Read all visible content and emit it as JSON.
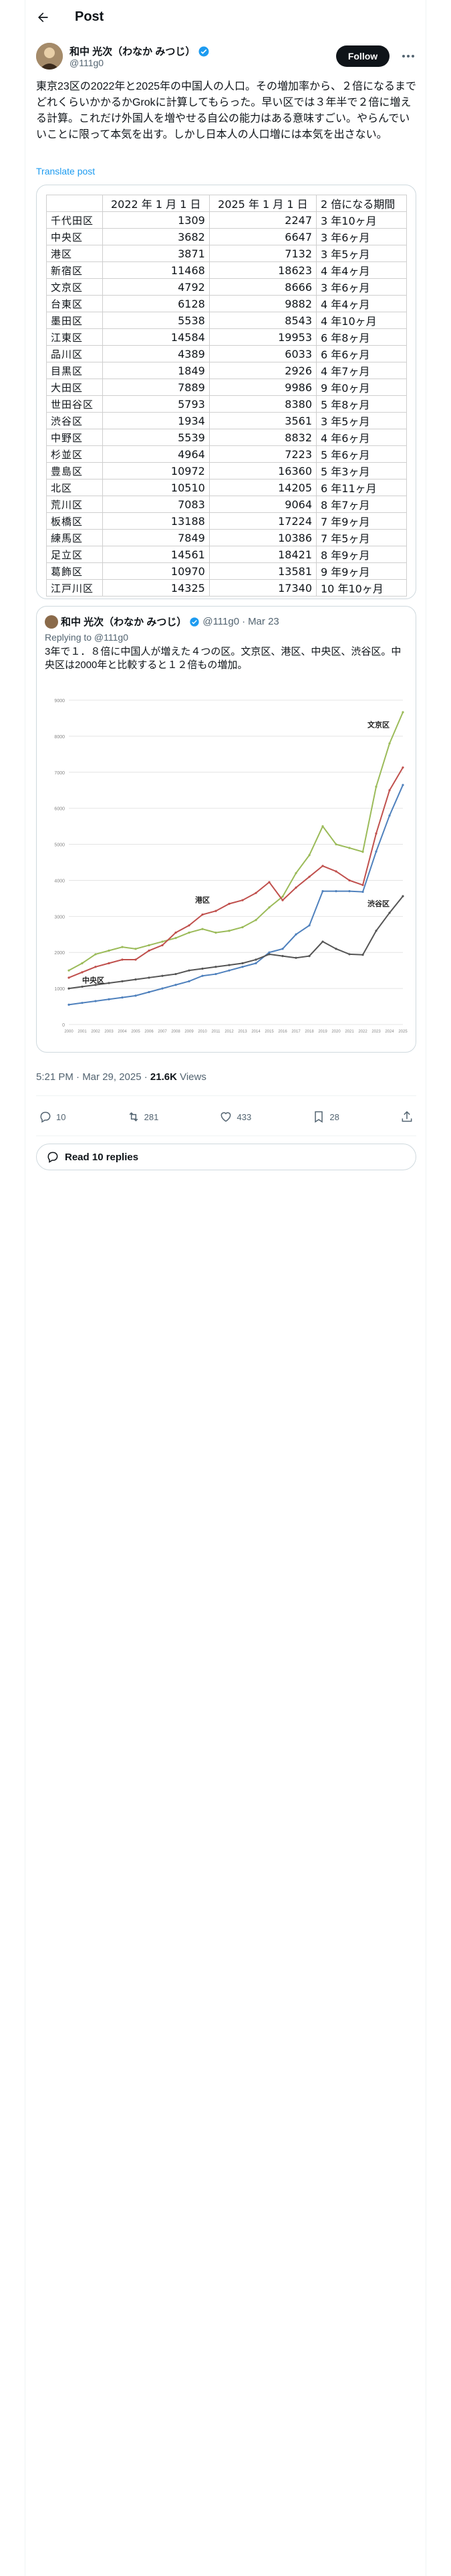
{
  "header": {
    "title": "Post"
  },
  "author": {
    "name": "和中 光次（わなか みつじ）",
    "handle": "@111g0",
    "follow_label": "Follow"
  },
  "post": {
    "text": "東京23区の2022年と2025年の中国人の人口。その増加率から、２倍になるまでどれくらいかかるかGrokに計算してもらった。早い区では３年半で２倍に増える計算。これだけ外国人を増やせる自公の能力はある意味すごい。やらんでいいことに限って本気を出す。しかし日本人の人口増には本気を出さない。",
    "translate_label": "Translate post"
  },
  "table": {
    "headers": [
      "",
      "2022 年 1 月 1 日",
      "2025 年 1 月 1 日",
      "2 倍になる期間"
    ],
    "rows": [
      [
        "千代田区",
        "1309",
        "2247",
        "3 年10ヶ月"
      ],
      [
        "中央区",
        "3682",
        "6647",
        "3 年6ヶ月"
      ],
      [
        "港区",
        "3871",
        "7132",
        "3 年5ヶ月"
      ],
      [
        "新宿区",
        "11468",
        "18623",
        "4 年4ヶ月"
      ],
      [
        "文京区",
        "4792",
        "8666",
        "3 年6ヶ月"
      ],
      [
        "台東区",
        "6128",
        "9882",
        "4 年4ヶ月"
      ],
      [
        "墨田区",
        "5538",
        "8543",
        "4 年10ヶ月"
      ],
      [
        "江東区",
        "14584",
        "19953",
        "6 年8ヶ月"
      ],
      [
        "品川区",
        "4389",
        "6033",
        "6 年6ヶ月"
      ],
      [
        "目黒区",
        "1849",
        "2926",
        "4 年7ヶ月"
      ],
      [
        "大田区",
        "7889",
        "9986",
        "9 年0ヶ月"
      ],
      [
        "世田谷区",
        "5793",
        "8380",
        "5 年8ヶ月"
      ],
      [
        "渋谷区",
        "1934",
        "3561",
        "3 年5ヶ月"
      ],
      [
        "中野区",
        "5539",
        "8832",
        "4 年6ヶ月"
      ],
      [
        "杉並区",
        "4964",
        "7223",
        "5 年6ヶ月"
      ],
      [
        "豊島区",
        "10972",
        "16360",
        "5 年3ヶ月"
      ],
      [
        "北区",
        "10510",
        "14205",
        "6 年11ヶ月"
      ],
      [
        "荒川区",
        "7083",
        "9064",
        "8 年7ヶ月"
      ],
      [
        "板橋区",
        "13188",
        "17224",
        "7 年9ヶ月"
      ],
      [
        "練馬区",
        "7849",
        "10386",
        "7 年5ヶ月"
      ],
      [
        "足立区",
        "14561",
        "18421",
        "8 年9ヶ月"
      ],
      [
        "葛飾区",
        "10970",
        "13581",
        "9 年9ヶ月"
      ],
      [
        "江戸川区",
        "14325",
        "17340",
        "10 年10ヶ月"
      ]
    ]
  },
  "quote": {
    "name": "和中 光次（わなか みつじ）",
    "handle": "@111g0",
    "date": "Mar 23",
    "replying_to": "Replying to @111g0",
    "text": "3年で１．８倍に中国人が増えた４つの区。文京区、港区、中央区、渋谷区。中央区は2000年と比較すると１２倍もの増加。"
  },
  "chart_data": {
    "type": "line",
    "x": [
      2000,
      2001,
      2002,
      2003,
      2004,
      2005,
      2006,
      2007,
      2008,
      2009,
      2010,
      2011,
      2012,
      2013,
      2014,
      2015,
      2016,
      2017,
      2018,
      2019,
      2020,
      2021,
      2022,
      2023,
      2024,
      2025
    ],
    "ylim": [
      0,
      9000
    ],
    "yticks": [
      0,
      1000,
      2000,
      3000,
      4000,
      5000,
      6000,
      7000,
      8000,
      9000
    ],
    "series": [
      {
        "name": "文京区",
        "color": "#9bbb59",
        "values": [
          1500,
          1700,
          1950,
          2050,
          2150,
          2100,
          2200,
          2300,
          2400,
          2550,
          2650,
          2550,
          2600,
          2700,
          2900,
          3250,
          3550,
          4200,
          4700,
          5500,
          5000,
          4900,
          4792,
          6600,
          7800,
          8666
        ]
      },
      {
        "name": "港区",
        "color": "#c0504d",
        "values": [
          1300,
          1450,
          1600,
          1700,
          1800,
          1800,
          2050,
          2200,
          2550,
          2750,
          3050,
          3150,
          3350,
          3450,
          3650,
          3950,
          3450,
          3800,
          4100,
          4400,
          4250,
          4000,
          3871,
          5300,
          6500,
          7132
        ]
      },
      {
        "name": "中央区",
        "color": "#4f81bd",
        "values": [
          550,
          600,
          650,
          700,
          750,
          800,
          900,
          1000,
          1100,
          1200,
          1350,
          1400,
          1500,
          1600,
          1700,
          2000,
          2100,
          2500,
          2750,
          3700,
          3700,
          3700,
          3682,
          4800,
          5800,
          6647
        ]
      },
      {
        "name": "渋谷区",
        "color": "#555555",
        "values": [
          1000,
          1050,
          1100,
          1150,
          1200,
          1250,
          1300,
          1350,
          1400,
          1500,
          1550,
          1600,
          1650,
          1700,
          1800,
          1950,
          1900,
          1850,
          1900,
          2300,
          2100,
          1950,
          1934,
          2600,
          3100,
          3561
        ]
      }
    ]
  },
  "meta": {
    "time": "5:21 PM · Mar 29, 2025 · ",
    "views_count": "21.6K",
    "views_label": " Views"
  },
  "actions": {
    "replies": "10",
    "reposts": "281",
    "likes": "433",
    "bookmarks": "28"
  },
  "read_replies_label": "Read 10 replies"
}
